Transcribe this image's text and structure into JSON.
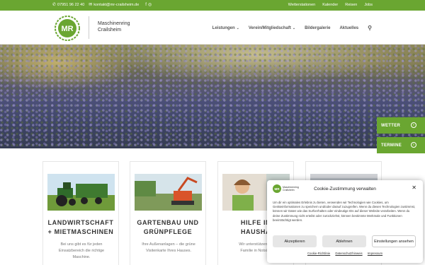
{
  "topbar": {
    "phone": "07951 96 22 40",
    "email": "kontakt@mr-crailsheim.de",
    "links": [
      "Wetterstationen",
      "Kalender",
      "Reisen",
      "Jobs"
    ]
  },
  "header": {
    "logo_text": "MR",
    "brand_line1": "Maschinenring",
    "brand_line2": "Crailsheim",
    "nav": [
      "Leistungen",
      "Verein/Mitgliedschaft",
      "Bildergalerie",
      "Aktuelles"
    ]
  },
  "side_buttons": {
    "wetter": "WETTER",
    "termine": "TERMINE"
  },
  "cards": [
    {
      "title_line1": "LANDWIRTSCHAFT",
      "title_line2": "+ MIETMASCHINEN",
      "text_line1": "Bei uns gibt es für jeden",
      "text_line2": "Einsatzbereich die richtige",
      "text_line3": "Maschine."
    },
    {
      "title_line1": "GARTENBAU UND",
      "title_line2": "GRÜNPFLEGE",
      "text_line1": "Ihre Außenanlagen – die grüne",
      "text_line2": "Visitenkarte Ihres Hauses.",
      "text_line3": ""
    },
    {
      "title_line1": "HILFE IN",
      "title_line2": "HAUSHA",
      "text_line1": "Wir unterstützen Sie",
      "text_line2": "Familie in Notsitua",
      "text_line3": ""
    },
    {
      "title_line1": "",
      "title_line2": "",
      "text_line1": "",
      "text_line2": "",
      "text_line3": ""
    }
  ],
  "cookie": {
    "logo_text": "MR",
    "logo_line1": "Maschinenring",
    "logo_line2": "Crailsheim",
    "title": "Cookie-Zustimmung verwalten",
    "text": "Um dir ein optimales Erlebnis zu bieten, verwenden wir Technologien wie Cookies, um Geräteinformationen zu speichern und/oder darauf zuzugreifen. Wenn du diesen Technologien zustimmst, können wir Daten wie das Surfverhalten oder eindeutige IDs auf dieser Website verarbeiten. Wenn du deine Zustimmung nicht erteilst oder zurückziehst, können bestimmte Merkmale und Funktionen beeinträchtigt werden.",
    "accept": "Akzeptieren",
    "deny": "Ablehnen",
    "settings": "Einstellungen ansehen",
    "link1": "Cookie-Richtlinie",
    "link2": "Datenschutzhinweis",
    "link3": "Impressum"
  },
  "colors": {
    "brand_green": "#6aa631"
  }
}
